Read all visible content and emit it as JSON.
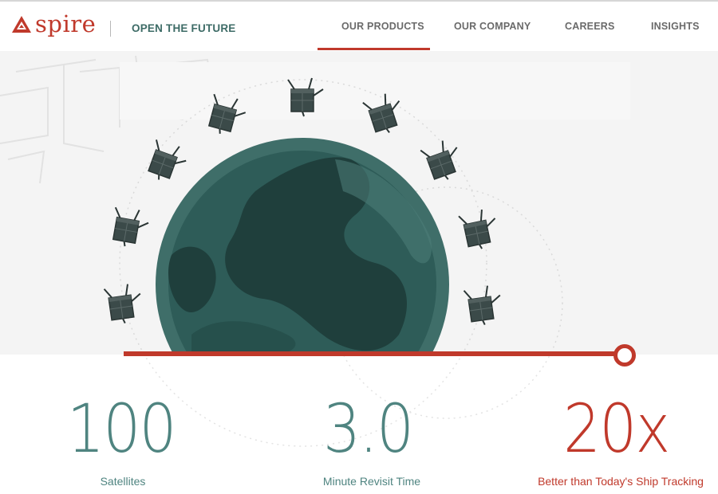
{
  "brand": {
    "name": "spire",
    "tagline": "OPEN THE FUTURE",
    "color": "#c0392b"
  },
  "nav": {
    "items": [
      {
        "label": "OUR PRODUCTS",
        "active": true
      },
      {
        "label": "OUR COMPANY",
        "active": false
      },
      {
        "label": "CAREERS",
        "active": false
      },
      {
        "label": "INSIGHTS",
        "active": false
      }
    ]
  },
  "hero": {
    "globe_color": "#2e5c58",
    "satellite_count_shown": 10,
    "slider_progress_percent": 93
  },
  "stats": [
    {
      "value": "100",
      "label": "Satellites",
      "color": "#4f8480"
    },
    {
      "value": "3.0",
      "label": "Minute Revisit Time",
      "color": "#4f8480"
    },
    {
      "value": "20x",
      "label": "Better than Today's Ship Tracking",
      "color": "#c0392b"
    }
  ],
  "icons": [
    "spire-logo-icon",
    "satellite-icon",
    "globe-icon",
    "slider-handle-icon"
  ]
}
